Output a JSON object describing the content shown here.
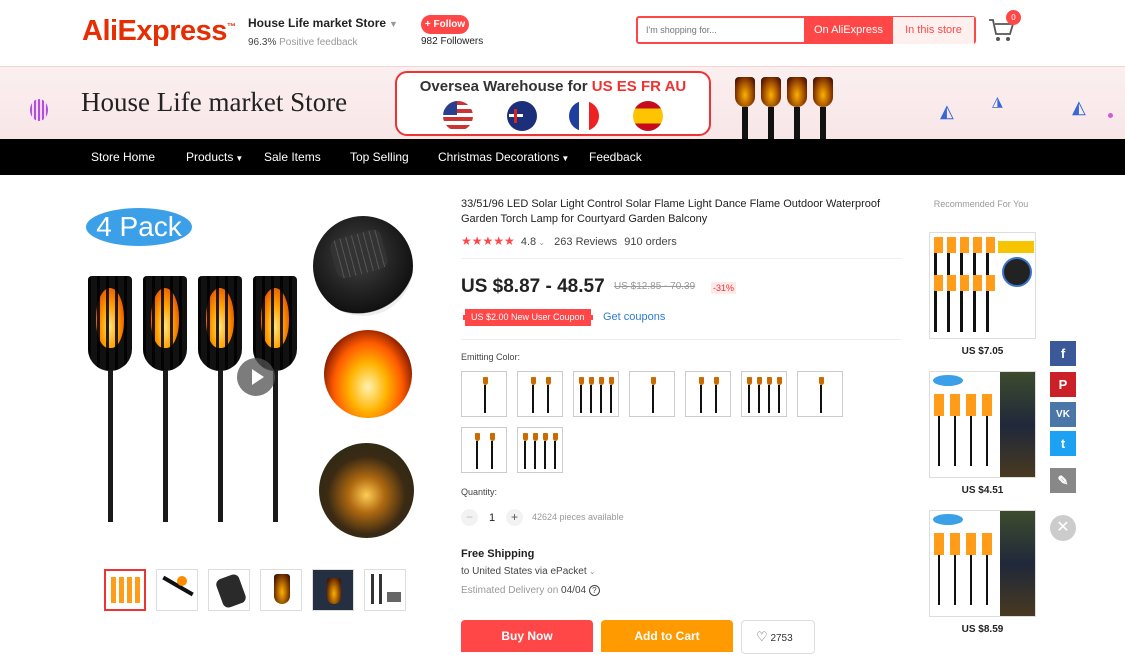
{
  "header": {
    "logo": "AliExpress",
    "store_name": "House Life market Store",
    "feedback_percent": "96.3%",
    "feedback_label": "Positive feedback",
    "follow_label": "+ Follow",
    "followers": "982 Followers",
    "search_placeholder": "I'm shopping for...",
    "search_on_ali": "On AliExpress",
    "search_in_store": "In this store",
    "cart_count": "0"
  },
  "banner": {
    "store_title": "House Life market Store",
    "oversea_prefix": "Oversea Warehouse for",
    "oversea_countries": "US ES FR AU"
  },
  "nav": [
    "Store Home",
    "Products",
    "Sale Items",
    "Top Selling",
    "Christmas Decorations",
    "Feedback"
  ],
  "gallery": {
    "badge": "4 Pack"
  },
  "product": {
    "title": "33/51/96 LED Solar Light Control Solar Flame Light Dance Flame Outdoor Waterproof Garden Torch Lamp for Courtyard Garden Balcony",
    "rating": "4.8",
    "reviews": "263 Reviews",
    "orders": "910 orders",
    "price": "US $8.87 - 48.57",
    "old_price": "US $12.85 - 70.39",
    "discount": "-31%",
    "coupon": "US $2.00 New User Coupon",
    "get_coupons": "Get coupons",
    "color_label": "Emitting Color:",
    "quantity_label": "Quantity:",
    "quantity": "1",
    "available": "42624 pieces available",
    "shipping_title": "Free Shipping",
    "shipping_to": "to United States via ePacket",
    "delivery_label": "Estimated Delivery on",
    "delivery_date": "04/04",
    "buy_now": "Buy Now",
    "add_to_cart": "Add to Cart",
    "wishlist_count": "2753"
  },
  "recommended": {
    "title": "Recommended For You",
    "items": [
      {
        "price": "US $7.05"
      },
      {
        "price": "US $4.51"
      },
      {
        "price": "US $8.59"
      }
    ]
  },
  "colors": {
    "accent": "#ff4747",
    "orange": "#ff9a00",
    "nav_bg": "#000000",
    "badge_blue": "#3ca0e8"
  }
}
